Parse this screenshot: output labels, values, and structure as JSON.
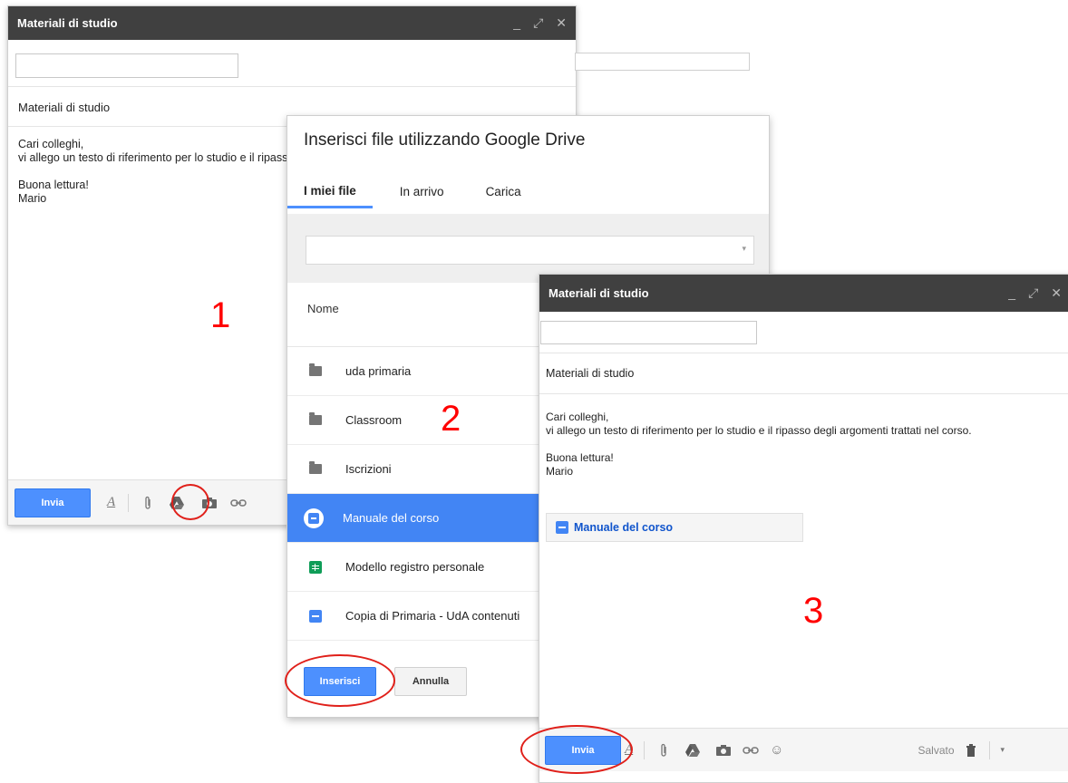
{
  "window1": {
    "title": "Materiali di studio",
    "subject": "Materiali di studio",
    "body": "Cari colleghi,\nvi allego un testo di riferimento per lo studio e il ripasso degli argomenti trattati nel corso.\n\nBuona lettura!\nMario",
    "send_label": "Invia"
  },
  "picker": {
    "title": "Inserisci file utilizzando Google Drive",
    "tabs": [
      "I miei file",
      "In arrivo",
      "Carica"
    ],
    "column_header": "Nome",
    "items": [
      {
        "name": "uda primaria",
        "type": "folder"
      },
      {
        "name": "Classroom",
        "type": "folder"
      },
      {
        "name": "Iscrizioni",
        "type": "folder"
      },
      {
        "name": "Manuale del corso",
        "type": "doc",
        "selected": true
      },
      {
        "name": "Modello registro personale",
        "type": "sheet"
      },
      {
        "name": "Copia di Primaria - UdA contenuti",
        "type": "doc"
      }
    ],
    "insert_label": "Inserisci",
    "cancel_label": "Annulla"
  },
  "window3": {
    "title": "Materiali di studio",
    "subject": "Materiali di studio",
    "body": "Cari colleghi,\nvi allego un testo di riferimento per lo studio e il ripasso degli argomenti trattati nel corso.\n\nBuona lettura!\nMario",
    "attachment": "Manuale del corso",
    "send_label": "Invia",
    "saved_label": "Salvato"
  },
  "steps": [
    "1",
    "2",
    "3"
  ],
  "colors": {
    "titlebar": "#404040",
    "accent": "#4d90fe",
    "selected": "#4285f4",
    "annotation": "#ff0000"
  }
}
